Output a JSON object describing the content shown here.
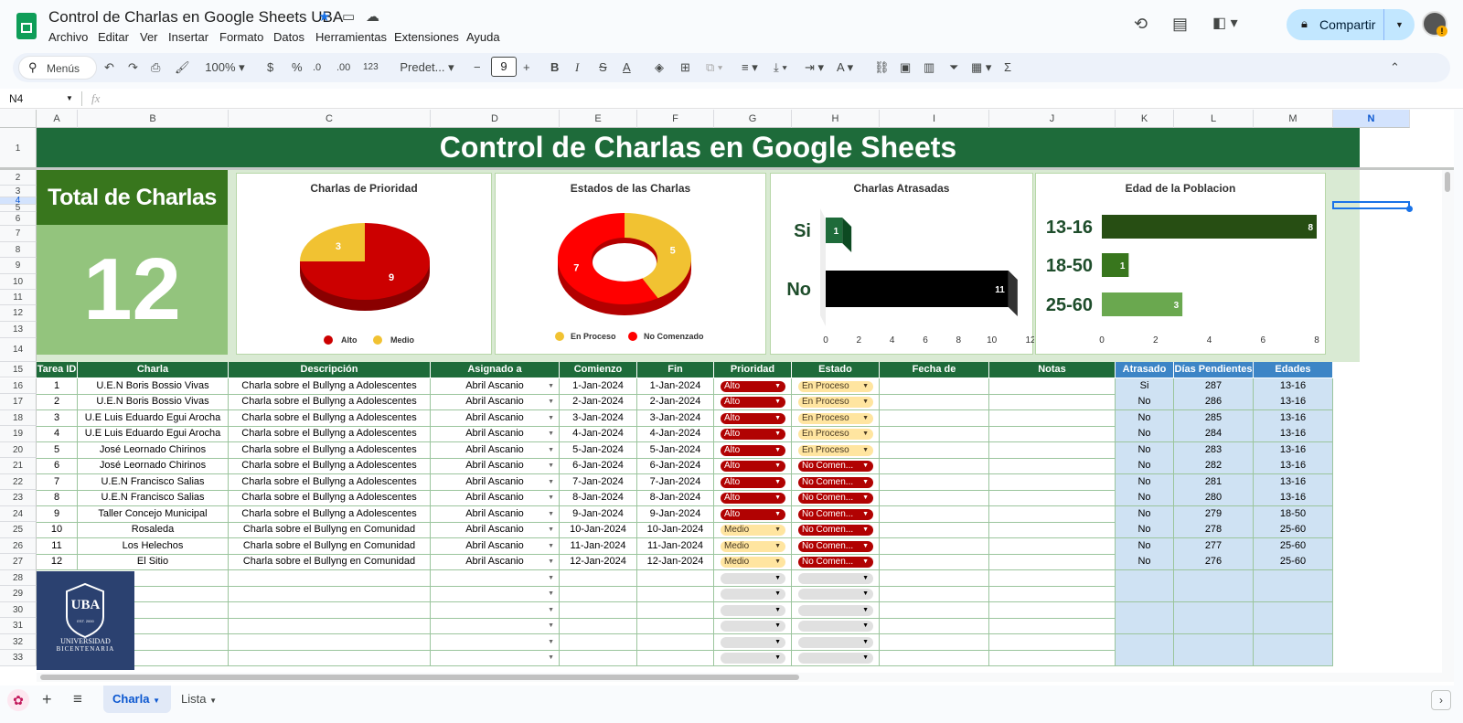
{
  "app": {
    "title": "Control de Charlas en Google Sheets UBA",
    "menu": [
      "Archivo",
      "Editar",
      "Ver",
      "Insertar",
      "Formato",
      "Datos",
      "Herramientas",
      "Extensiones",
      "Ayuda"
    ],
    "share_label": "Compartir"
  },
  "toolbar": {
    "search": "Menús",
    "zoom": "100%",
    "currency": "$",
    "percent": "%",
    "dec_less": ".0",
    "dec_more": ".00",
    "num_format": "123",
    "font": "Predet...",
    "font_size": "9"
  },
  "formula_bar": {
    "cell_ref": "N4",
    "fx": "fx"
  },
  "columns": [
    "A",
    "B",
    "C",
    "D",
    "E",
    "F",
    "G",
    "H",
    "I",
    "J",
    "K",
    "L",
    "M",
    "N"
  ],
  "banner": "Control de Charlas en Google Sheets",
  "total": {
    "label": "Total de Charlas",
    "value": "12"
  },
  "charts": [
    {
      "title": "Charlas de Prioridad",
      "type": "pie",
      "labels": [
        "Alto",
        "Medio"
      ],
      "values": [
        9,
        3
      ],
      "colors": [
        "#cc0000",
        "#f1c232"
      ]
    },
    {
      "title": "Estados de las Charlas",
      "type": "donut",
      "labels": [
        "En Proceso",
        "No Comenzado"
      ],
      "values": [
        5,
        7
      ],
      "colors": [
        "#f1c232",
        "#ff0000"
      ]
    },
    {
      "title": "Charlas Atrasadas",
      "type": "bar",
      "categories": [
        "Si",
        "No"
      ],
      "values": [
        1,
        11
      ],
      "xticks": [
        "0",
        "2",
        "4",
        "6",
        "8",
        "10",
        "12"
      ],
      "xmax": 12
    },
    {
      "title": "Edad de la Poblacion",
      "type": "bar",
      "categories": [
        "13-16",
        "18-50",
        "25-60"
      ],
      "values": [
        8,
        1,
        3
      ],
      "xticks": [
        "0",
        "2",
        "4",
        "6",
        "8"
      ],
      "xmax": 8
    }
  ],
  "table": {
    "headers": [
      "Tarea ID",
      "Charla",
      "Descripción",
      "Asignado a",
      "Comienzo",
      "Fin",
      "Prioridad",
      "Estado",
      "Fecha de Completación",
      "Notas",
      "Atrasado",
      "Días Pendientes",
      "Edades"
    ],
    "rows": [
      [
        "1",
        "U.E.N Boris Bossio Vivas",
        "Charla sobre el Bullyng a Adolescentes",
        "Abril Ascanio",
        "1-Jan-2024",
        "1-Jan-2024",
        "Alto",
        "En Proceso",
        "",
        "",
        "Si",
        "287",
        "13-16"
      ],
      [
        "2",
        "U.E.N Boris Bossio Vivas",
        "Charla sobre el Bullyng a Adolescentes",
        "Abril Ascanio",
        "2-Jan-2024",
        "2-Jan-2024",
        "Alto",
        "En Proceso",
        "",
        "",
        "No",
        "286",
        "13-16"
      ],
      [
        "3",
        "U.E Luis Eduardo Egui Arocha",
        "Charla sobre el Bullyng a Adolescentes",
        "Abril Ascanio",
        "3-Jan-2024",
        "3-Jan-2024",
        "Alto",
        "En Proceso",
        "",
        "",
        "No",
        "285",
        "13-16"
      ],
      [
        "4",
        "U.E Luis Eduardo Egui Arocha",
        "Charla sobre el Bullyng a Adolescentes",
        "Abril Ascanio",
        "4-Jan-2024",
        "4-Jan-2024",
        "Alto",
        "En Proceso",
        "",
        "",
        "No",
        "284",
        "13-16"
      ],
      [
        "5",
        "José Leornado Chirinos",
        "Charla sobre el Bullyng a Adolescentes",
        "Abril Ascanio",
        "5-Jan-2024",
        "5-Jan-2024",
        "Alto",
        "En Proceso",
        "",
        "",
        "No",
        "283",
        "13-16"
      ],
      [
        "6",
        "José Leornado Chirinos",
        "Charla sobre el Bullyng a Adolescentes",
        "Abril Ascanio",
        "6-Jan-2024",
        "6-Jan-2024",
        "Alto",
        "No Comen...",
        "",
        "",
        "No",
        "282",
        "13-16"
      ],
      [
        "7",
        "U.E.N Francisco Salias",
        "Charla sobre el Bullyng a Adolescentes",
        "Abril Ascanio",
        "7-Jan-2024",
        "7-Jan-2024",
        "Alto",
        "No Comen...",
        "",
        "",
        "No",
        "281",
        "13-16"
      ],
      [
        "8",
        "U.E.N Francisco Salias",
        "Charla sobre el Bullyng a Adolescentes",
        "Abril Ascanio",
        "8-Jan-2024",
        "8-Jan-2024",
        "Alto",
        "No Comen...",
        "",
        "",
        "No",
        "280",
        "13-16"
      ],
      [
        "9",
        "Taller Concejo Municipal",
        "Charla sobre el Bullyng a Adolescentes",
        "Abril Ascanio",
        "9-Jan-2024",
        "9-Jan-2024",
        "Alto",
        "No Comen...",
        "",
        "",
        "No",
        "279",
        "18-50"
      ],
      [
        "10",
        "Rosaleda",
        "Charla sobre el Bullyng en Comunidad",
        "Abril Ascanio",
        "10-Jan-2024",
        "10-Jan-2024",
        "Medio",
        "No Comen...",
        "",
        "",
        "No",
        "278",
        "25-60"
      ],
      [
        "11",
        "Los Helechos",
        "Charla sobre el Bullyng en Comunidad",
        "Abril Ascanio",
        "11-Jan-2024",
        "11-Jan-2024",
        "Medio",
        "No Comen...",
        "",
        "",
        "No",
        "277",
        "25-60"
      ],
      [
        "12",
        "El Sitio",
        "Charla sobre el Bullyng en Comunidad",
        "Abril Ascanio",
        "12-Jan-2024",
        "12-Jan-2024",
        "Medio",
        "No Comen...",
        "",
        "",
        "No",
        "276",
        "25-60"
      ]
    ]
  },
  "logo": {
    "text": "UBA",
    "line1": "UNIVERSIDAD",
    "line2": "BICENTENARIA",
    "est": "EST. 2000"
  },
  "sheet_tabs": [
    "Charla",
    "Lista"
  ],
  "colors": {
    "green": "#1e6b3a",
    "light_green": "#93c47d",
    "blue_band": "#cfe2f3",
    "share": "#c2e7ff"
  }
}
